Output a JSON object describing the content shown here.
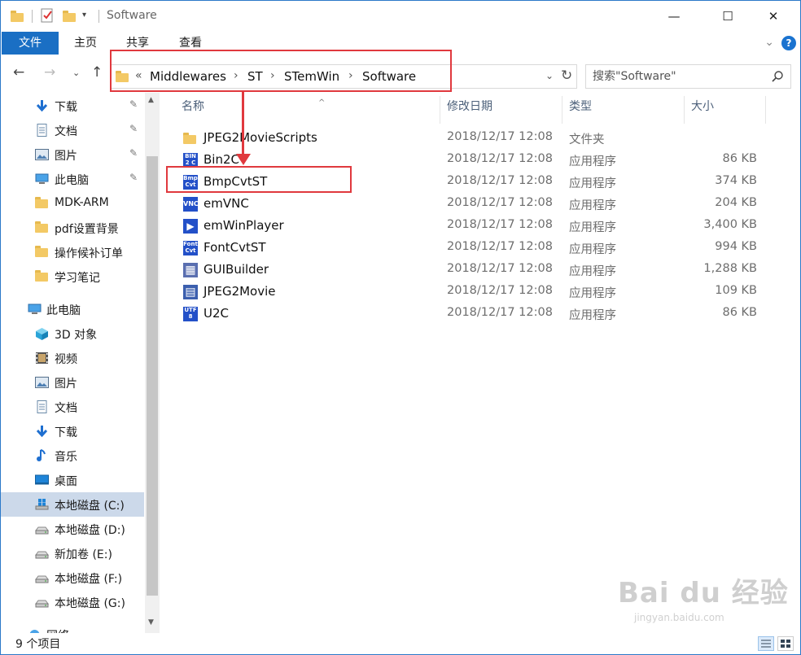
{
  "titlebar": {
    "title": "Software",
    "minimize": "—",
    "maximize": "☐",
    "close": "✕"
  },
  "ribbon": {
    "tabs": [
      "文件",
      "主页",
      "共享",
      "查看"
    ],
    "help": "?"
  },
  "address": {
    "overflow": "«",
    "crumbs": [
      "Middlewares",
      "ST",
      "STemWin",
      "Software"
    ],
    "separator": "›"
  },
  "search": {
    "placeholder": "搜索\"Software\""
  },
  "sidebar": {
    "quick_access": [
      {
        "label": "下载",
        "icon": "download-icon",
        "pinned": true
      },
      {
        "label": "文档",
        "icon": "document-icon",
        "pinned": true
      },
      {
        "label": "图片",
        "icon": "picture-icon",
        "pinned": true
      },
      {
        "label": "此电脑",
        "icon": "computer-icon",
        "pinned": true
      },
      {
        "label": "MDK-ARM",
        "icon": "folder-icon",
        "pinned": false
      },
      {
        "label": "pdf设置背景",
        "icon": "folder-icon",
        "pinned": false
      },
      {
        "label": "操作候补订单",
        "icon": "folder-icon",
        "pinned": false
      },
      {
        "label": "学习笔记",
        "icon": "folder-icon",
        "pinned": false
      }
    ],
    "this_pc": {
      "label": "此电脑",
      "icon": "computer-icon"
    },
    "pc_items": [
      {
        "label": "3D 对象",
        "icon": "3d-objects-icon"
      },
      {
        "label": "视频",
        "icon": "video-icon"
      },
      {
        "label": "图片",
        "icon": "picture-icon"
      },
      {
        "label": "文档",
        "icon": "document-icon"
      },
      {
        "label": "下载",
        "icon": "download-icon"
      },
      {
        "label": "音乐",
        "icon": "music-icon"
      },
      {
        "label": "桌面",
        "icon": "desktop-icon"
      },
      {
        "label": "本地磁盘 (C:)",
        "icon": "windows-drive-icon",
        "selected": true
      },
      {
        "label": "本地磁盘 (D:)",
        "icon": "drive-icon"
      },
      {
        "label": "新加卷 (E:)",
        "icon": "drive-icon"
      },
      {
        "label": "本地磁盘 (F:)",
        "icon": "drive-icon"
      },
      {
        "label": "本地磁盘 (G:)",
        "icon": "drive-icon"
      }
    ],
    "partial": "网络",
    "pin_glyph": "📌"
  },
  "columns": {
    "name": "名称",
    "date": "修改日期",
    "type": "类型",
    "size": "大小"
  },
  "files": [
    {
      "name": "JPEG2MovieScripts",
      "date": "2018/12/17 12:08",
      "type": "文件夹",
      "size": "",
      "icon": "folder-icon",
      "icon_text": ""
    },
    {
      "name": "Bin2C",
      "date": "2018/12/17 12:08",
      "type": "应用程序",
      "size": "86 KB",
      "icon": "bin2c-app-icon",
      "icon_text": "BIN 2 C"
    },
    {
      "name": "BmpCvtST",
      "date": "2018/12/17 12:08",
      "type": "应用程序",
      "size": "374 KB",
      "icon": "bmpcvt-app-icon",
      "icon_text": "Bmp Cvt"
    },
    {
      "name": "emVNC",
      "date": "2018/12/17 12:08",
      "type": "应用程序",
      "size": "204 KB",
      "icon": "emvnc-app-icon",
      "icon_text": "VNC"
    },
    {
      "name": "emWinPlayer",
      "date": "2018/12/17 12:08",
      "type": "应用程序",
      "size": "3,400 KB",
      "icon": "player-app-icon",
      "icon_text": "▶"
    },
    {
      "name": "FontCvtST",
      "date": "2018/12/17 12:08",
      "type": "应用程序",
      "size": "994 KB",
      "icon": "fontcvt-app-icon",
      "icon_text": "Font Cvt"
    },
    {
      "name": "GUIBuilder",
      "date": "2018/12/17 12:08",
      "type": "应用程序",
      "size": "1,288 KB",
      "icon": "guibuilder-app-icon",
      "icon_text": "▦"
    },
    {
      "name": "JPEG2Movie",
      "date": "2018/12/17 12:08",
      "type": "应用程序",
      "size": "109 KB",
      "icon": "jpeg2movie-app-icon",
      "icon_text": "▤"
    },
    {
      "name": "U2C",
      "date": "2018/12/17 12:08",
      "type": "应用程序",
      "size": "86 KB",
      "icon": "u2c-app-icon",
      "icon_text": "UTF 8"
    }
  ],
  "status": {
    "count": "9 个项目"
  },
  "watermark": {
    "main": "Bai du 经验",
    "sub": "jingyan.baidu.com"
  },
  "colors": {
    "accent": "#1a6fc4",
    "highlight": "#e0393e",
    "selected": "#ccd9ea"
  }
}
